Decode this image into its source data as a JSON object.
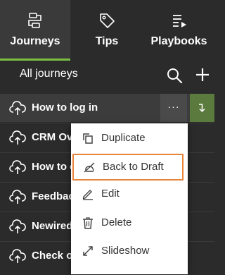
{
  "tabs": [
    {
      "label": "Journeys",
      "icon": "journeys-icon",
      "active": true
    },
    {
      "label": "Tips",
      "icon": "tag-icon",
      "active": false
    },
    {
      "label": "Playbooks",
      "icon": "playbook-list-icon",
      "active": false
    }
  ],
  "header": {
    "title": "All journeys"
  },
  "journeys": [
    {
      "label": "How to log in"
    },
    {
      "label": "CRM Ove"
    },
    {
      "label": "How to c"
    },
    {
      "label": "Feedback"
    },
    {
      "label": "Newired"
    },
    {
      "label": "Check ou"
    }
  ],
  "row_actions": {
    "more_label": "···"
  },
  "context_menu": [
    {
      "label": "Duplicate",
      "icon": "duplicate-icon"
    },
    {
      "label": "Back to Draft",
      "icon": "draft-icon",
      "highlighted": true
    },
    {
      "label": "Edit",
      "icon": "pencil-icon"
    },
    {
      "label": "Delete",
      "icon": "trash-icon"
    },
    {
      "label": "Slideshow",
      "icon": "expand-icon"
    }
  ],
  "colors": {
    "accent": "#7cc043",
    "highlight_border": "#e8833a",
    "background": "#2b2b2b"
  }
}
